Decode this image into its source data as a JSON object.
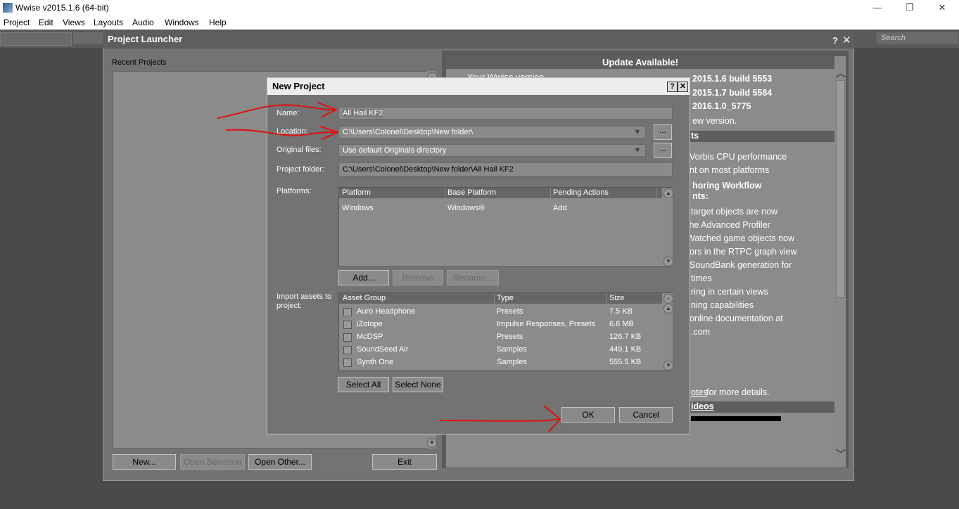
{
  "window": {
    "title": "Wwise v2015.1.6 (64-bit)",
    "minimize": "—",
    "maximize": "❐",
    "close": "✕"
  },
  "menu": [
    "Project",
    "Edit",
    "Views",
    "Layouts",
    "Audio",
    "Windows",
    "Help"
  ],
  "toolbar": {
    "search_placeholder": "Search"
  },
  "launcher": {
    "title": "Project Launcher",
    "help": "?",
    "close": "✕",
    "recent_label": "Recent Projects",
    "buttons": {
      "new": "New...",
      "open_selection": "Open Selection",
      "open_other": "Open Other...",
      "exit": "Exit"
    }
  },
  "news": {
    "header": "Update Available!",
    "lines": [
      "Your Wwise version",
      "2015.1.6 build 5553",
      "2015.1.7 build 5584",
      "2016.1.0_5775",
      "ew version.",
      "ts",
      "Vorbis CPU performance",
      "nt on most platforms",
      "horing Workflow",
      "nts:",
      "target objects are now",
      " the Advanced Profiler",
      " Watched game objects now",
      "ors in the RTPC graph view",
      " SoundBank generation for",
      "times",
      "ring in certain views",
      "ning capabilities",
      " online documentation at",
      ".com",
      "otes",
      " for more details.",
      "ideos"
    ]
  },
  "dialog": {
    "title": "New Project",
    "help": "?",
    "close": "✕",
    "name_label": "Name:",
    "name_value": "All Hail KF2",
    "location_label": "Location:",
    "location_value": "C:\\Users\\Colonel\\Desktop\\New folder\\",
    "original_label": "Original files:",
    "original_value": "Use default Originals directory",
    "folder_label": "Project folder:",
    "folder_value": "C:\\Users\\Colonel\\Desktop\\New folder\\All Hail KF2",
    "browse": "...",
    "platforms_label": "Platforms:",
    "platform_columns": [
      "Platform",
      "Base Platform",
      "Pending Actions"
    ],
    "platform_rows": [
      [
        "Windows",
        "Windows®",
        "Add"
      ]
    ],
    "platform_buttons": {
      "add": "Add...",
      "remove": "Remove",
      "rename": "Rename..."
    },
    "import_label_1": "Import assets to",
    "import_label_2": "project:",
    "asset_columns": [
      "Asset Group",
      "Type",
      "Size"
    ],
    "asset_rows": [
      [
        "Auro Headphone",
        "Presets",
        "7.5 KB"
      ],
      [
        "iZotope",
        "Impulse Responses, Presets",
        "6.6 MB"
      ],
      [
        "McDSP",
        "Presets",
        "126.7 KB"
      ],
      [
        "SoundSeed Air",
        "Samples",
        "449.1 KB"
      ],
      [
        "Synth One",
        "Samples",
        "555.5 KB"
      ]
    ],
    "select_all": "Select All",
    "select_none": "Select None",
    "ok": "OK",
    "cancel": "Cancel"
  },
  "annotation_color": "#e01010"
}
